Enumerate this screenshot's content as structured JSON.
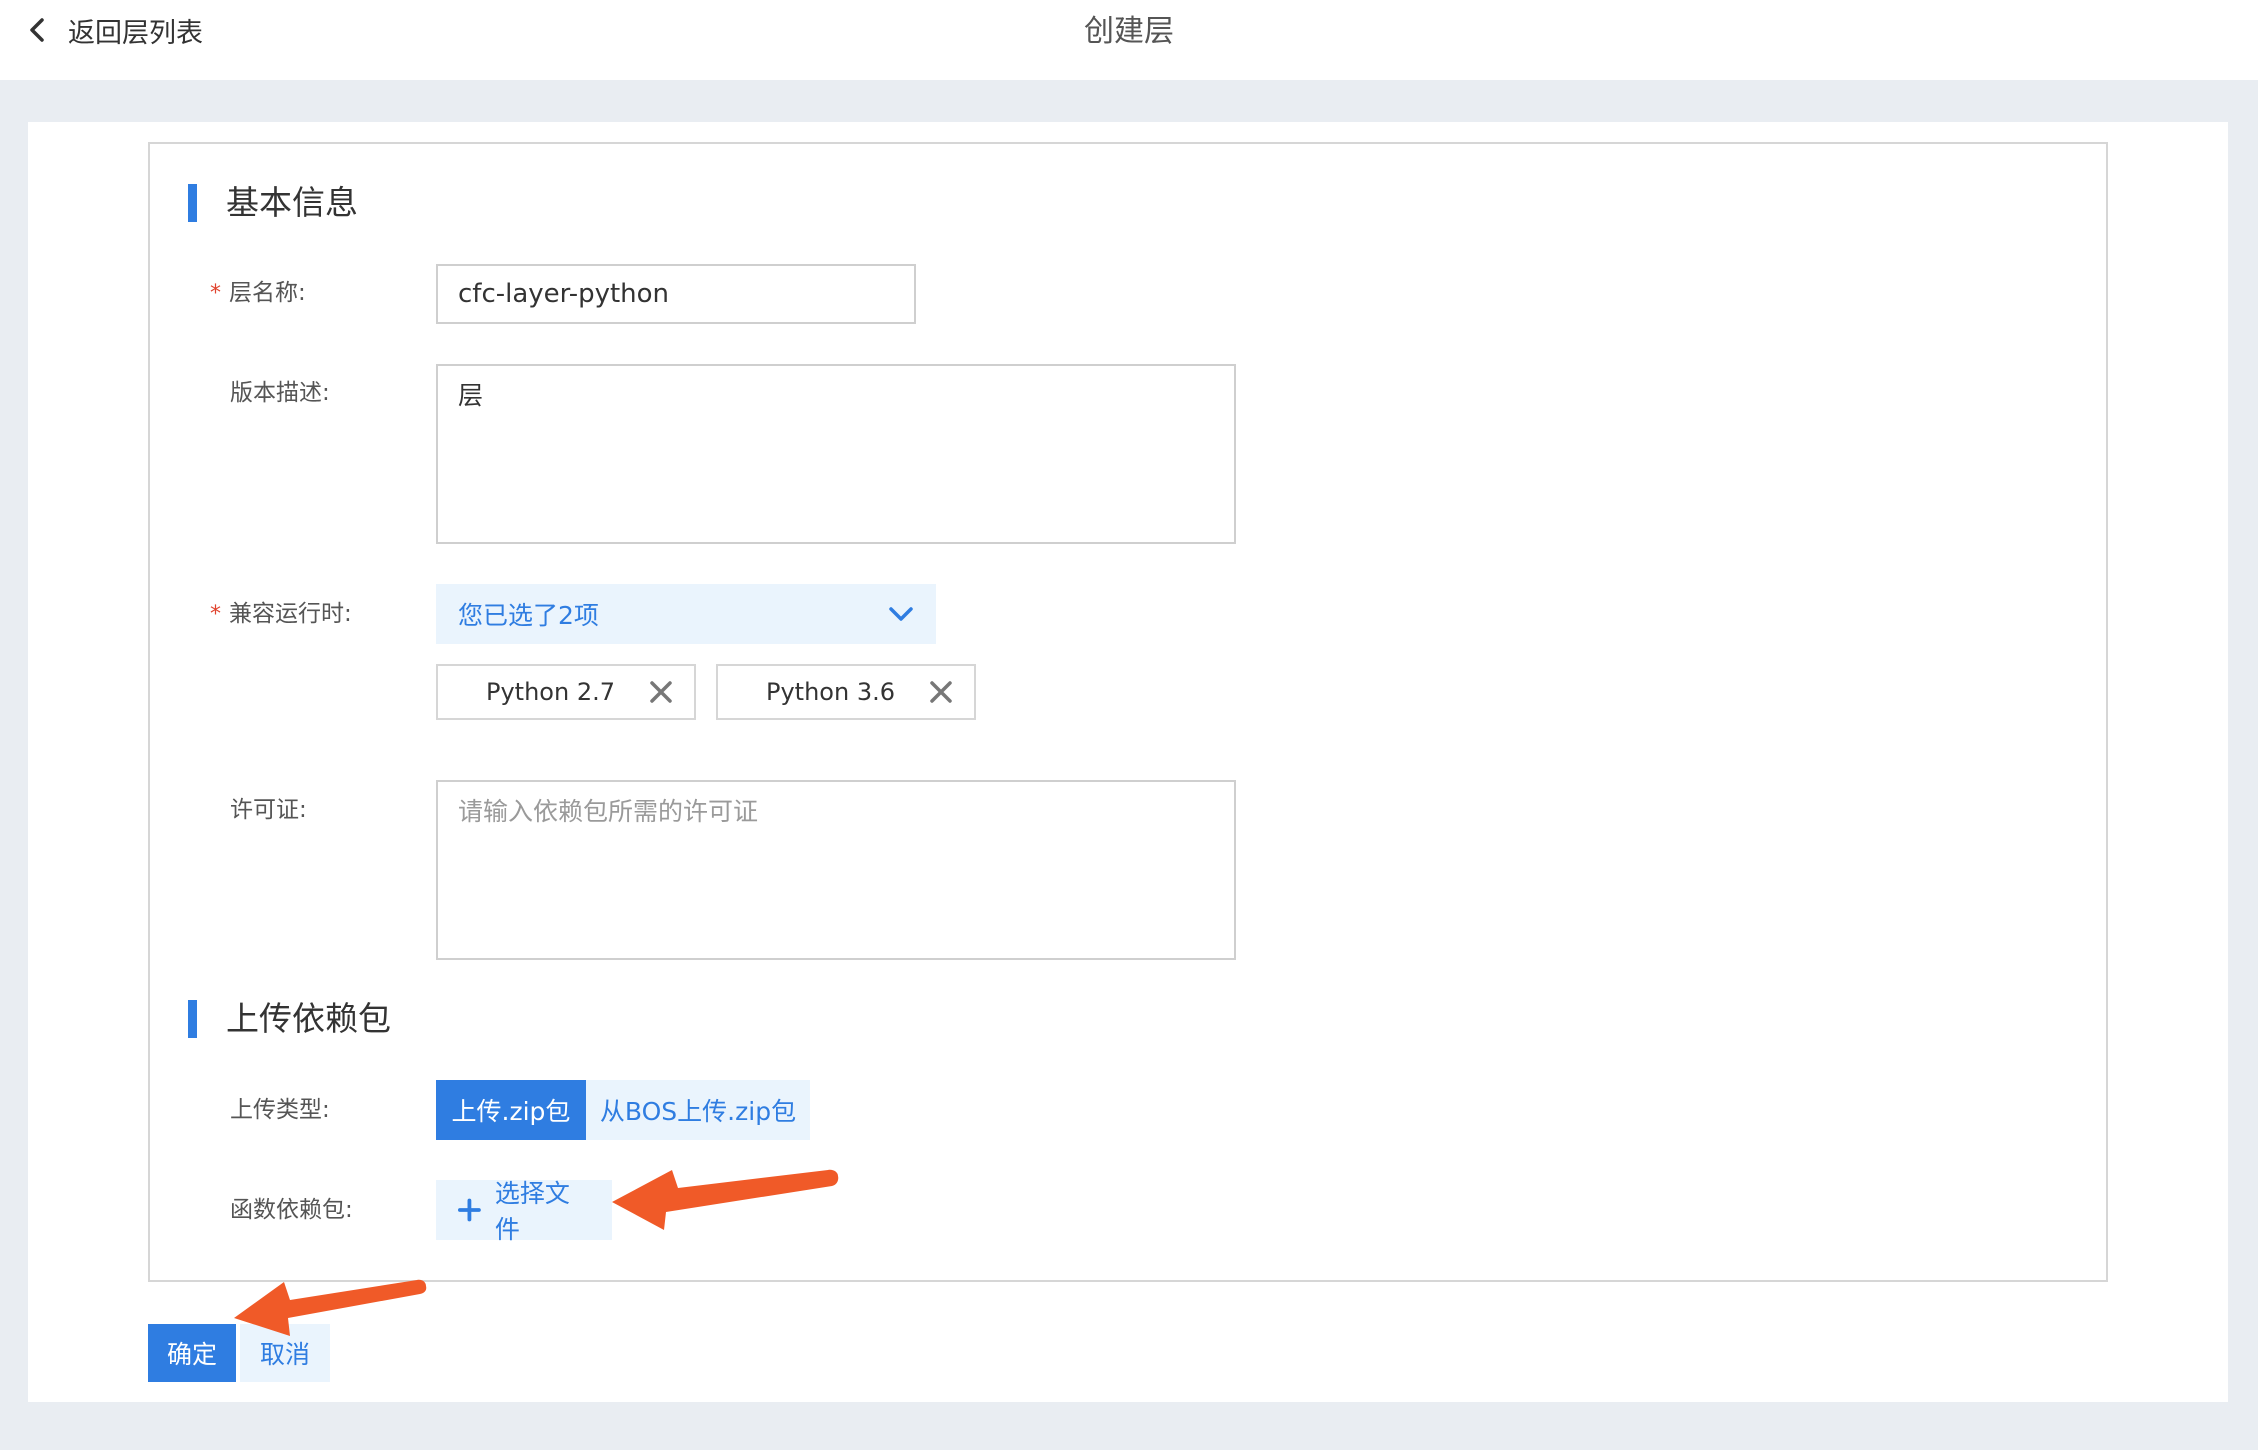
{
  "header": {
    "back_label": "返回层列表",
    "title": "创建层"
  },
  "basic_section": {
    "title": "基本信息",
    "required_mark": "*",
    "layer_name": {
      "label": "层名称:",
      "value": "cfc-layer-python"
    },
    "version_desc": {
      "label": "版本描述:",
      "value": "层"
    },
    "runtime": {
      "label": "兼容运行时:",
      "selected_summary": "您已选了2项",
      "tags": [
        "Python 2.7",
        "Python 3.6"
      ]
    },
    "license": {
      "label": "许可证:",
      "placeholder": "请输入依赖包所需的许可证"
    }
  },
  "upload_section": {
    "title": "上传依赖包",
    "upload_type": {
      "label": "上传类型:",
      "options": [
        "上传.zip包",
        "从BOS上传.zip包"
      ],
      "selected_index": 0
    },
    "package": {
      "label": "函数依赖包:",
      "button_label": "选择文件"
    }
  },
  "footer": {
    "confirm_label": "确定",
    "cancel_label": "取消"
  },
  "colors": {
    "accent": "#2f7de1",
    "accent_light_bg": "#eaf4fd",
    "required": "#e0432e",
    "annotation_arrow": "#f05a28"
  }
}
